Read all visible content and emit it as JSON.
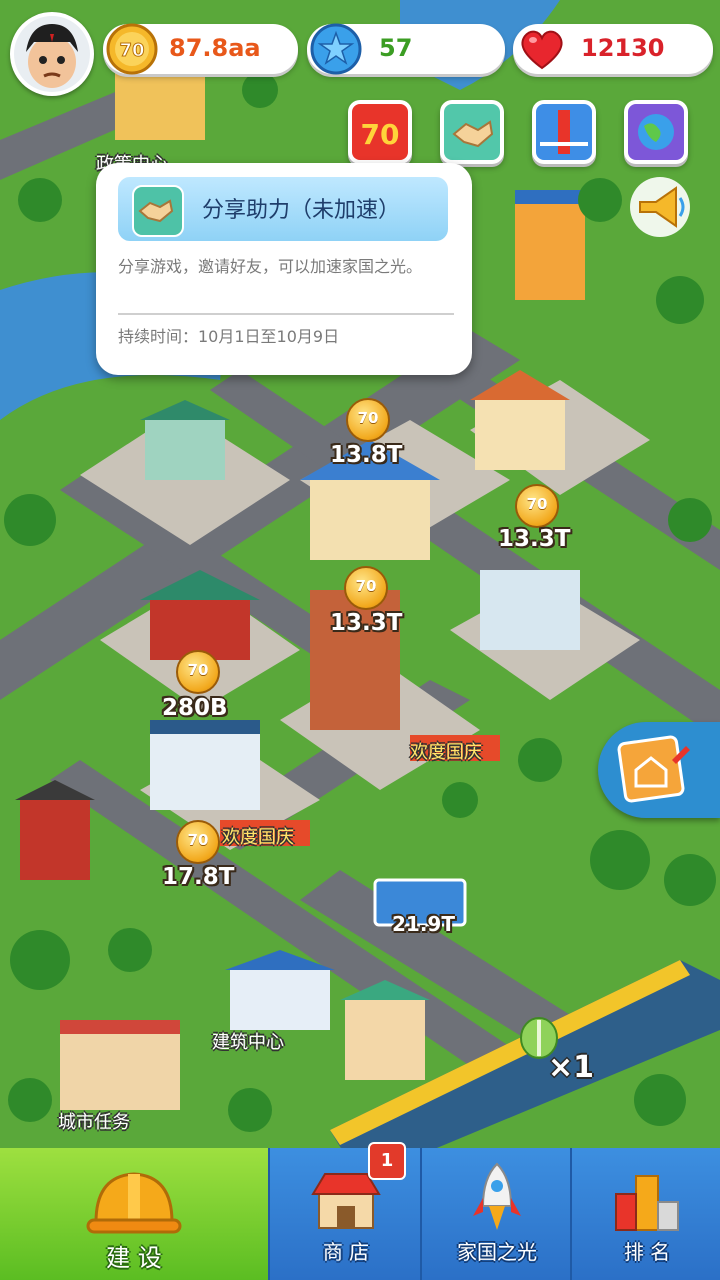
{
  "resources": {
    "coins": {
      "value": "87.8aa",
      "icon": "coin-70-icon"
    },
    "stars": {
      "value": "57",
      "icon": "blue-star-icon"
    },
    "hearts": {
      "value": "12130",
      "icon": "heart-icon"
    }
  },
  "avatar": {
    "icon": "player-avatar-icon"
  },
  "events": [
    {
      "name": "anniversary-70-event",
      "icon": "70-icon"
    },
    {
      "name": "share-assist-event",
      "icon": "handshake-icon"
    },
    {
      "name": "bridge-event",
      "icon": "bridge-icon"
    },
    {
      "name": "earth-event",
      "icon": "earth-icon"
    }
  ],
  "tooltip": {
    "title": "分享助力（未加速）",
    "description": "分享游戏，邀请好友，可以加速家国之光。",
    "duration": "持续时间：10月1日至10月9日"
  },
  "map": {
    "top_place": "政策中心",
    "building_values": [
      "13.8T",
      "13.3T",
      "13.3T",
      "280B",
      "17.8T"
    ],
    "billboard_value": "21.9T",
    "places": [
      "建筑中心",
      "城市任务"
    ],
    "train_multiplier": "×1",
    "banners": [
      "欢度国庆",
      "欢度国庆"
    ],
    "coin_text": "70"
  },
  "nav": {
    "build": "建 设",
    "shop": "商 店",
    "glory": "家国之光",
    "rank": "排 名",
    "shop_badge": "1"
  },
  "colors": {
    "grass": "#5aa83a",
    "road": "#6e7178",
    "water": "#3f8fd0",
    "nav_green": "#5bbd22",
    "nav_blue": "#2b70c7",
    "coin_text": "#e8581a",
    "star_text": "#3b9d23",
    "heart_text": "#d9222a"
  }
}
